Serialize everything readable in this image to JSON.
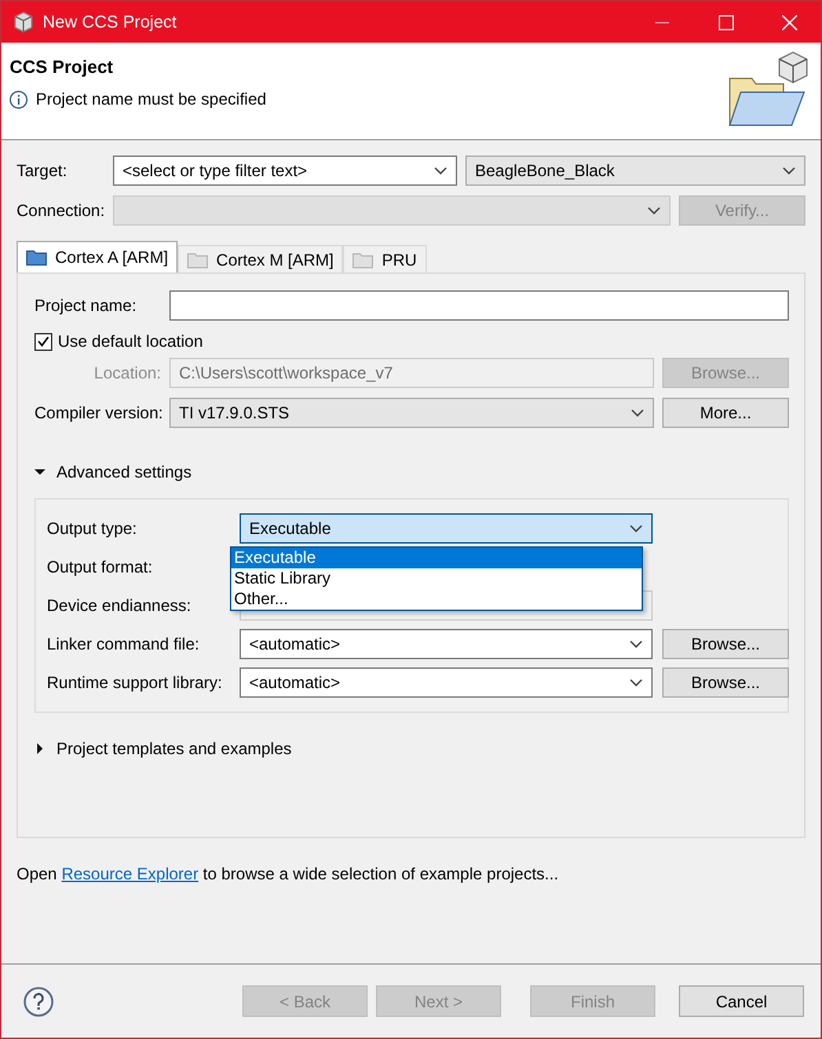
{
  "window": {
    "title": "New CCS Project"
  },
  "header": {
    "title": "CCS Project",
    "message": "Project name must be specified"
  },
  "target": {
    "label": "Target:",
    "value": "<select or type filter text>",
    "board": "BeagleBone_Black"
  },
  "connection": {
    "label": "Connection:",
    "disabled": true,
    "button": {
      "label": "Verify...",
      "disabled": true
    }
  },
  "tabs": [
    {
      "label": "Cortex A [ARM]",
      "selected": true
    },
    {
      "label": "Cortex M [ARM]",
      "selected": false
    },
    {
      "label": "PRU",
      "selected": false
    }
  ],
  "project_name": {
    "label": "Project name:"
  },
  "use_default_location": {
    "label": "Use default location",
    "checked": true
  },
  "location": {
    "label": "Location:",
    "value": "C:\\Users\\scott\\workspace_v7",
    "disabled": true,
    "button": {
      "label": "Browse...",
      "disabled": true
    }
  },
  "compiler_version": {
    "label": "Compiler version:",
    "value": "TI v17.9.0.STS",
    "button": {
      "label": "More...",
      "disabled": false
    }
  },
  "advanced_settings": {
    "label": "Advanced settings",
    "expanded": true,
    "fields": [
      {
        "label": "Output type:",
        "kind": "combo",
        "value": "Executable",
        "open": true,
        "options": [
          {
            "label": "Executable",
            "selected": true
          },
          {
            "label": "Static Library",
            "selected": false
          },
          {
            "label": "Other...",
            "selected": false
          }
        ]
      },
      {
        "label": "Output format:",
        "kind": "hidden"
      },
      {
        "label": "Device endianness:",
        "kind": "readonly"
      },
      {
        "label": "Linker command file:",
        "kind": "combo",
        "value": "<automatic>",
        "open": false,
        "button": "Browse..."
      },
      {
        "label": "Runtime support library:",
        "kind": "combo",
        "value": "<automatic>",
        "open": false,
        "button": "Browse..."
      }
    ]
  },
  "project_templates": {
    "label": "Project templates and examples",
    "expanded": false
  },
  "footer_note": {
    "before": "Open ",
    "link": "Resource Explorer",
    "after": " to browse a wide selection of example projects..."
  },
  "buttons": [
    {
      "label": "< Back",
      "disabled": true
    },
    {
      "label": "Next >",
      "disabled": true
    },
    {
      "label": "Finish",
      "disabled": true
    },
    {
      "label": "Cancel",
      "disabled": false
    }
  ]
}
